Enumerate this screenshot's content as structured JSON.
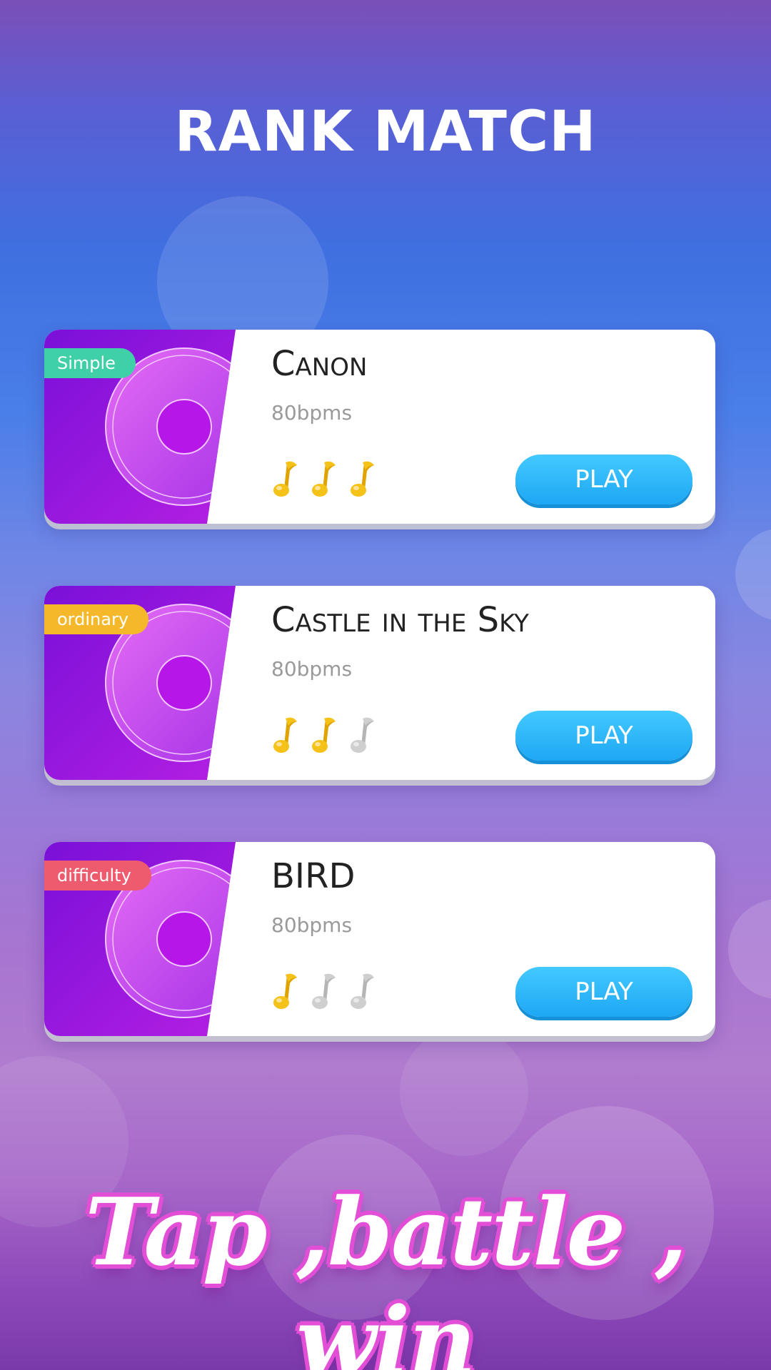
{
  "screen": {
    "title": "RANK MATCH",
    "slogan": "Tap ,battle , win"
  },
  "colors": {
    "simple_tag": "#3fd0a8",
    "ordinary_tag": "#f5b82a",
    "difficulty_tag": "#ef5b6e",
    "play_button": "#2fb5f8",
    "note_active": "#f5c21a",
    "note_inactive": "#cfcfcf",
    "art_purple": "#9b1fe0"
  },
  "songs": [
    {
      "level": "Simple",
      "title": "Canon",
      "bpm": "80bpms",
      "play_label": "PLAY",
      "rating": 3,
      "rating_max": 3
    },
    {
      "level": "ordinary",
      "title": "Castle in the Sky",
      "bpm": "80bpms",
      "play_label": "PLAY",
      "rating": 2,
      "rating_max": 3
    },
    {
      "level": "difficulty",
      "title": "BIRD",
      "bpm": "80bpms",
      "play_label": "PLAY",
      "rating": 1,
      "rating_max": 3
    }
  ],
  "icons": {
    "art": "vinyl-disc-icon",
    "rating": "music-note-icon"
  }
}
